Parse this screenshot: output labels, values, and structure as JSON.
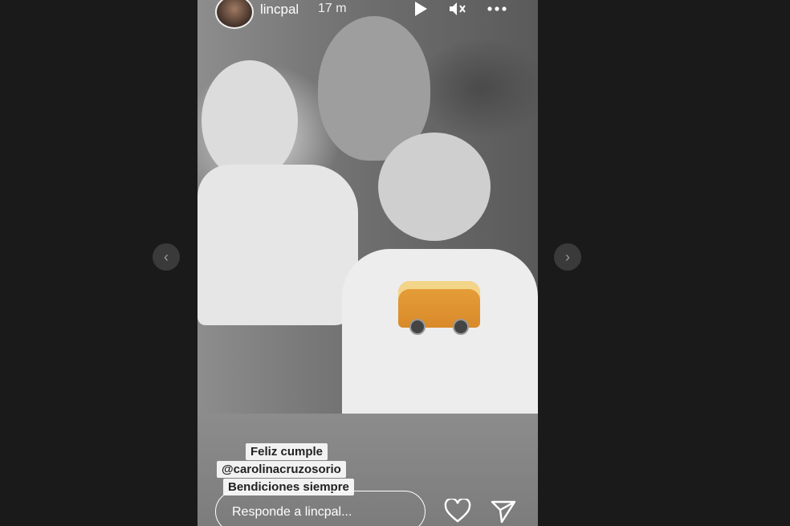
{
  "story": {
    "username": "lincpal",
    "time_ago": "17 m",
    "icons": {
      "avatar": "profile-avatar",
      "play": "play-icon",
      "mute": "speaker-muted-icon",
      "more": "more-dots-icon",
      "like": "heart-icon",
      "send": "paper-plane-icon"
    },
    "caption": {
      "line1": "Feliz cumple",
      "line2": "@carolinacruzosorio",
      "line3": "Bendiciones siempre"
    },
    "reply_placeholder": "Responde a lincpal..."
  },
  "navigation": {
    "prev_label": "‹",
    "next_label": "›"
  },
  "colors": {
    "page_background": "#1a1a1a",
    "nav_button": "#3a3a3a",
    "text": "#ffffff"
  }
}
